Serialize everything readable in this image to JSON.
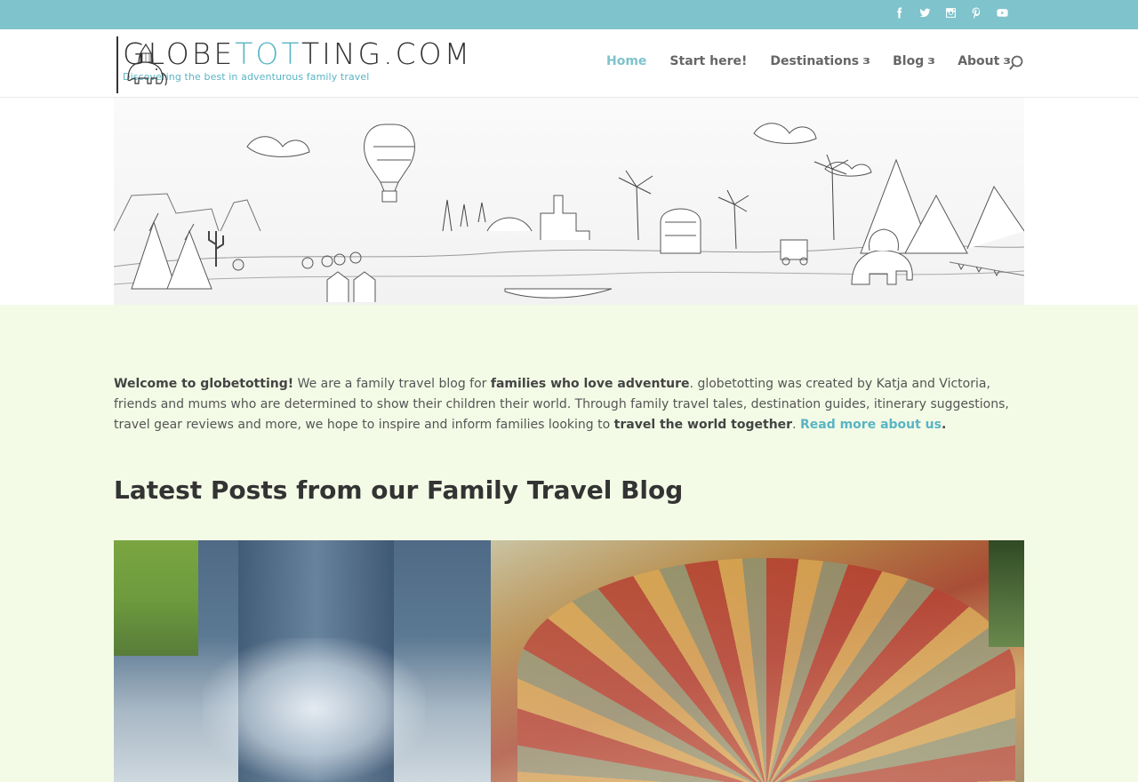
{
  "site": {
    "logo_title_a": "GLOBE",
    "logo_title_b": "TOT",
    "logo_title_c": "TING.COM",
    "logo_tagline": "Discovering the best in adventurous family travel"
  },
  "social": [
    "facebook-icon",
    "twitter-icon",
    "instagram-icon",
    "pinterest-icon",
    "youtube-icon"
  ],
  "nav": {
    "items": [
      {
        "label": "Home",
        "active": true,
        "has_dropdown": false
      },
      {
        "label": "Start here!",
        "active": false,
        "has_dropdown": false
      },
      {
        "label": "Destinations",
        "active": false,
        "has_dropdown": true
      },
      {
        "label": "Blog",
        "active": false,
        "has_dropdown": true
      },
      {
        "label": "About",
        "active": false,
        "has_dropdown": true
      }
    ],
    "dropdown_glyph": "3"
  },
  "intro": {
    "welcome": "Welcome to globetotting!",
    "part1": " We are a family travel blog for ",
    "bold1": "families who love adventure",
    "part2": ". globetotting was created by Katja and Victoria, friends and mums who are determined to show their children their world. Through family travel tales, destination guides, itinerary suggestions, travel gear reviews and more, we hope to inspire and inform families looking to ",
    "bold2": "travel the world together",
    "part3": ". ",
    "link": "Read more about us",
    "part4": "."
  },
  "posts": {
    "heading": "Latest Posts from our Family Travel Blog"
  },
  "colors": {
    "accent": "#7fc3cc",
    "link": "#5ab4c4",
    "page_bg": "#f3fbe6"
  }
}
